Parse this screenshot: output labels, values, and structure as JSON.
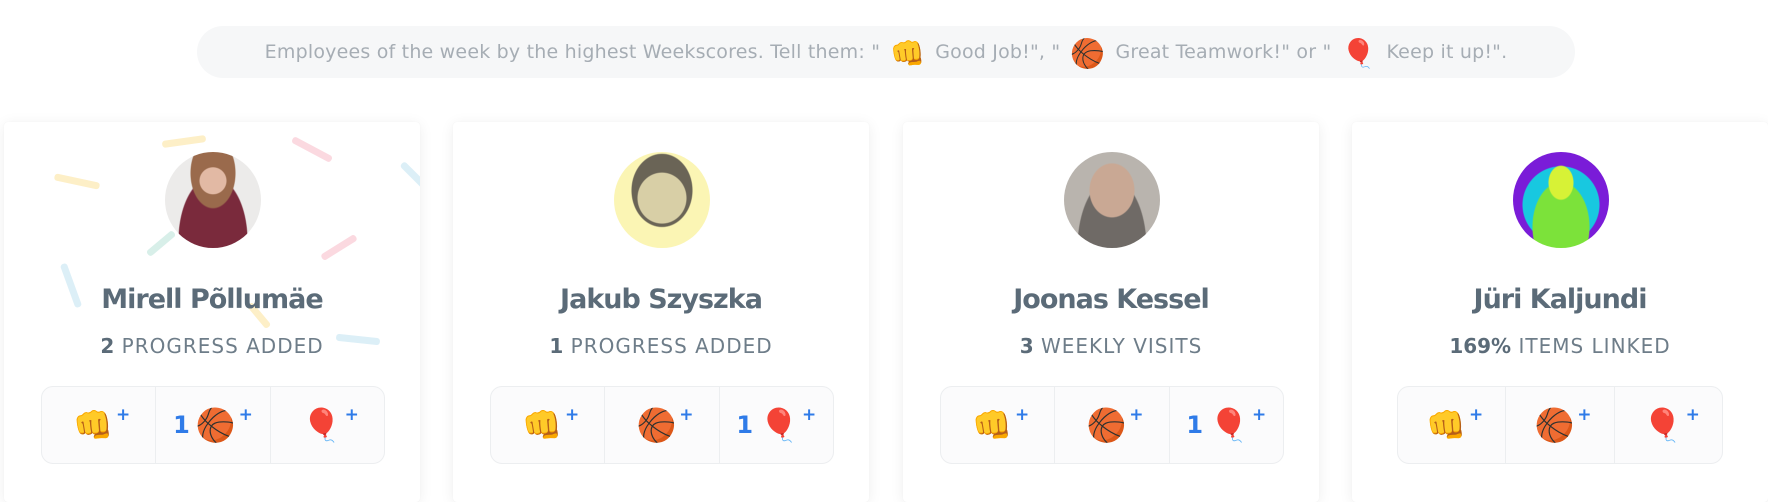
{
  "banner": {
    "part1": "Employees of the week by the highest Weekscores. Tell them: \"",
    "emoji1": "👊",
    "part2": "Good Job!\", \"",
    "emoji2": "🏀",
    "part3": "Great Teamwork!\" or \"",
    "emoji3": "🎈",
    "part4": "Keep it up!\"."
  },
  "reaction_icons": {
    "good_job": "👊",
    "teamwork": "🏀",
    "keep_it_up": "🎈",
    "plus": "+"
  },
  "employees": [
    {
      "name": "Mirell Põllumäe",
      "stat_value": "2",
      "stat_label": "PROGRESS ADDED",
      "reactions": {
        "good_job": "",
        "teamwork": "1",
        "keep_it_up": ""
      },
      "avatar": "photo-woman-dark-top"
    },
    {
      "name": "Jakub Szyszka",
      "stat_value": "1",
      "stat_label": "PROGRESS ADDED",
      "reactions": {
        "good_job": "",
        "teamwork": "",
        "keep_it_up": "1"
      },
      "avatar": "photo-man-sepia"
    },
    {
      "name": "Joonas Kessel",
      "stat_value": "3",
      "stat_label": "WEEKLY VISITS",
      "reactions": {
        "good_job": "",
        "teamwork": "",
        "keep_it_up": "1"
      },
      "avatar": "photo-man-glasses"
    },
    {
      "name": "Jüri Kaljundi",
      "stat_value": "169%",
      "stat_label": "ITEMS LINKED",
      "reactions": {
        "good_job": "",
        "teamwork": "",
        "keep_it_up": ""
      },
      "avatar": "photo-thermal"
    }
  ],
  "colors": {
    "accent": "#2f7be8",
    "name_text": "#5b6b78",
    "banner_bg": "#f6f7f8"
  }
}
